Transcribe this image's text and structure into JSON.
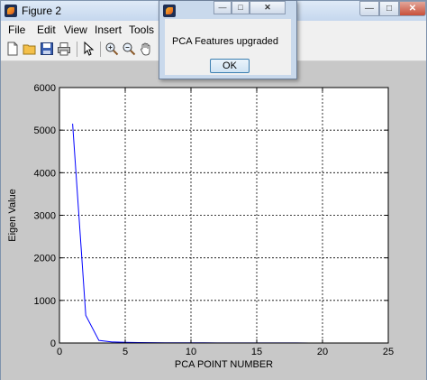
{
  "window": {
    "title": "Figure 2",
    "controls": {
      "minimize": "—",
      "maximize": "□",
      "close": "✕"
    }
  },
  "menubar": {
    "items": [
      "File",
      "Edit",
      "View",
      "Insert",
      "Tools"
    ]
  },
  "toolbar": {
    "icons": [
      "new-file-icon",
      "open-folder-icon",
      "save-icon",
      "print-icon",
      "pointer-icon",
      "zoom-in-icon",
      "zoom-out-icon",
      "pan-hand-icon"
    ]
  },
  "dialog": {
    "message": "PCA Features upgraded",
    "ok_label": "OK",
    "controls": {
      "minimize": "—",
      "maximize": "□",
      "close": "✕"
    }
  },
  "colors": {
    "line": "#0000ff",
    "grid": "#000000",
    "plot_bg": "#ffffff",
    "figure_bg": "#c8c8c8"
  },
  "chart_data": {
    "type": "line",
    "title": "",
    "xlabel": "PCA POINT NUMBER",
    "ylabel": "Eigen Value",
    "xlim": [
      0,
      25
    ],
    "ylim": [
      0,
      6000
    ],
    "xticks": [
      0,
      5,
      10,
      15,
      20,
      25
    ],
    "yticks": [
      0,
      1000,
      2000,
      3000,
      4000,
      5000,
      6000
    ],
    "grid": true,
    "series": [
      {
        "color": "#0000ff",
        "x": [
          1,
          2,
          3,
          4,
          5,
          6,
          7,
          8,
          9,
          10,
          11,
          12,
          13,
          14,
          15,
          16,
          17,
          18,
          19,
          20,
          21
        ],
        "y": [
          5150,
          650,
          60,
          25,
          15,
          10,
          8,
          6,
          5,
          4,
          4,
          3,
          3,
          3,
          2,
          2,
          2,
          2,
          1,
          1,
          1
        ]
      }
    ]
  }
}
